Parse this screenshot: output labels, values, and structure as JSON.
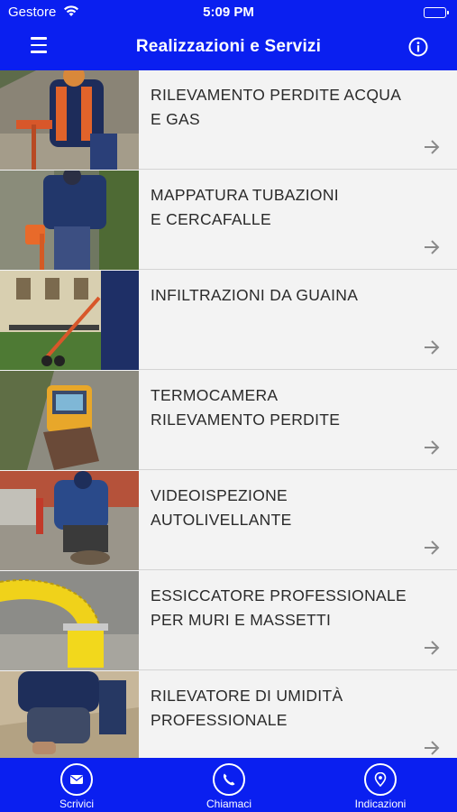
{
  "status_bar": {
    "carrier": "Gestore",
    "time": "5:09 PM",
    "wifi_icon": "wifi-icon",
    "battery_icon": "battery-icon"
  },
  "nav_bar": {
    "title": "Realizzazioni e Servizi",
    "menu_icon": "hamburger-menu-icon",
    "info_icon": "info-icon"
  },
  "services": [
    {
      "label": "RILEVAMENTO PERDITE ACQUA\nE GAS"
    },
    {
      "label": "MAPPATURA  TUBAZIONI\nE CERCAFALLE"
    },
    {
      "label": "INFILTRAZIONI DA GUAINA"
    },
    {
      "label": "TERMOCAMERA\nRILEVAMENTO PERDITE"
    },
    {
      "label": "VIDEOISPEZIONE\nAUTOLIVELLANTE"
    },
    {
      "label": "ESSICCATORE PROFESSIONALE\nPER MURI E MASSETTI"
    },
    {
      "label": "RILEVATORE DI UMIDITÀ\nPROFESSIONALE"
    }
  ],
  "tab_bar": {
    "tabs": [
      {
        "label": "Scrivici",
        "icon": "envelope-icon"
      },
      {
        "label": "Chiamaci",
        "icon": "phone-icon"
      },
      {
        "label": "Indicazioni",
        "icon": "location-pin-icon"
      }
    ]
  },
  "colors": {
    "accent": "#0a1ff0",
    "row_background": "#f3f3f3",
    "text": "#2a2a2a"
  }
}
